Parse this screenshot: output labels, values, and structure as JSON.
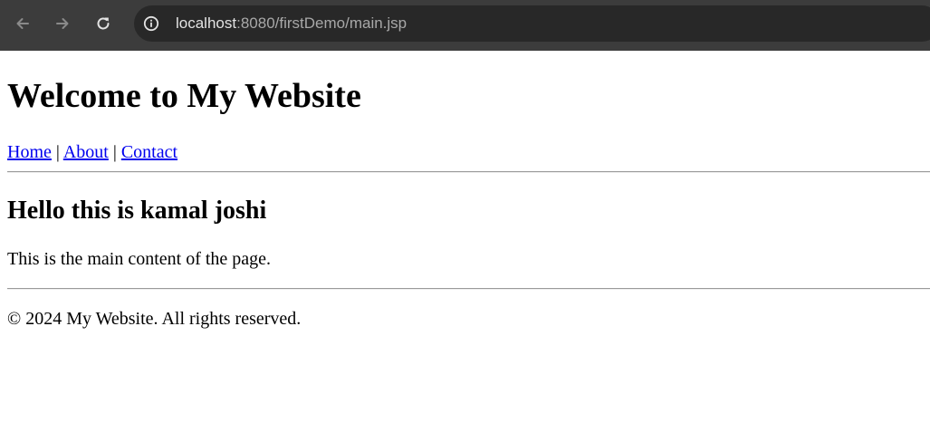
{
  "browser": {
    "url_host": "localhost",
    "url_rest": ":8080/firstDemo/main.jsp",
    "icons": {
      "back": "arrow-left-icon",
      "forward": "arrow-right-icon",
      "reload": "reload-icon",
      "site_info": "info-circle-icon"
    }
  },
  "header": {
    "title": "Welcome to My Website"
  },
  "nav": {
    "links": [
      {
        "label": "Home"
      },
      {
        "label": "About"
      },
      {
        "label": "Contact"
      }
    ],
    "separator": "|"
  },
  "main": {
    "heading": "Hello this is kamal joshi",
    "text": "This is the main content of the page."
  },
  "footer": {
    "text": "© 2024 My Website. All rights reserved."
  },
  "colors": {
    "link": "#0000ee",
    "toolbar": "#3c3c3c",
    "omnibox": "#282828"
  }
}
